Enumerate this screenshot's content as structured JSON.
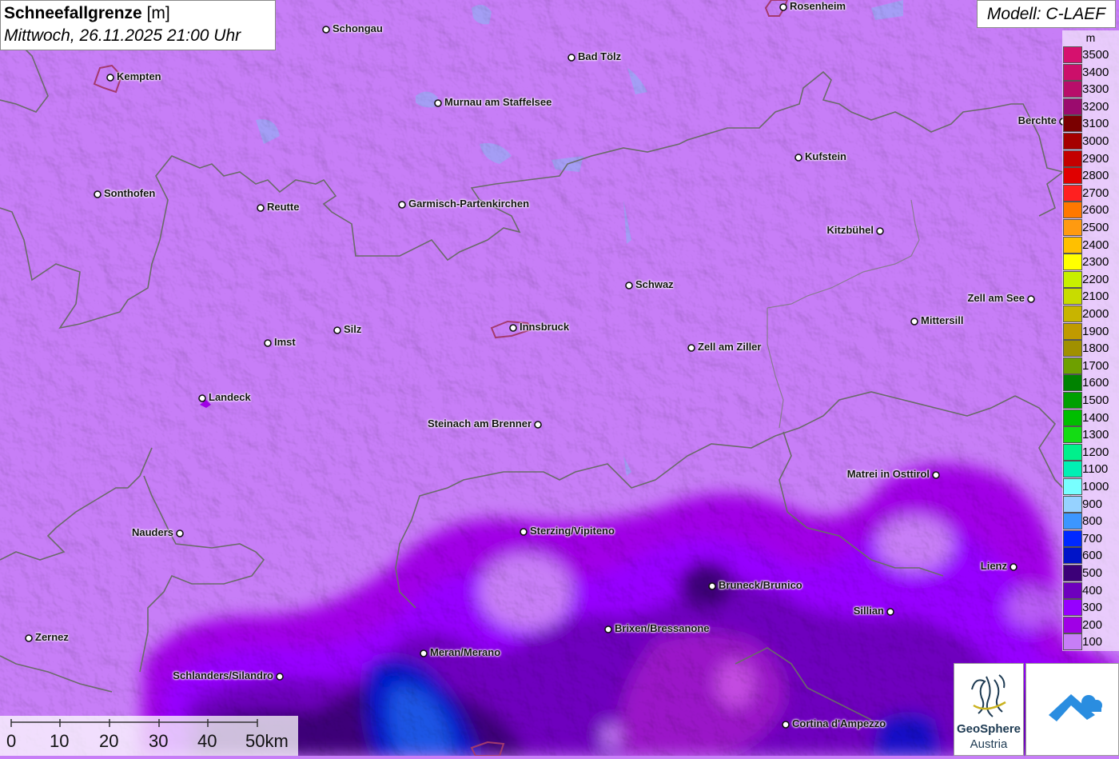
{
  "header": {
    "title": "Schneefallgrenze",
    "unit": "[m]",
    "datetime": "Mittwoch, 26.11.2025 21:00 Uhr"
  },
  "model": "Modell: C-LAEF",
  "legend": {
    "unit": "m",
    "items": [
      {
        "label": "3500",
        "color": "#d6116e"
      },
      {
        "label": "3400",
        "color": "#cc0f6a"
      },
      {
        "label": "3300",
        "color": "#b80e6a"
      },
      {
        "label": "3200",
        "color": "#9b0b6e"
      },
      {
        "label": "3100",
        "color": "#7a0000"
      },
      {
        "label": "3000",
        "color": "#a50000"
      },
      {
        "label": "2900",
        "color": "#c40000"
      },
      {
        "label": "2800",
        "color": "#e00000"
      },
      {
        "label": "2700",
        "color": "#ff2020"
      },
      {
        "label": "2600",
        "color": "#ff7800"
      },
      {
        "label": "2500",
        "color": "#ff9a10"
      },
      {
        "label": "2400",
        "color": "#ffc000"
      },
      {
        "label": "2300",
        "color": "#ffff00"
      },
      {
        "label": "2200",
        "color": "#c8f000"
      },
      {
        "label": "2100",
        "color": "#c8dc00"
      },
      {
        "label": "2000",
        "color": "#c8b400"
      },
      {
        "label": "1900",
        "color": "#c09a00"
      },
      {
        "label": "1800",
        "color": "#a09000"
      },
      {
        "label": "1700",
        "color": "#6ea000"
      },
      {
        "label": "1600",
        "color": "#008200"
      },
      {
        "label": "1500",
        "color": "#00a000"
      },
      {
        "label": "1400",
        "color": "#00be00"
      },
      {
        "label": "1300",
        "color": "#14dc14"
      },
      {
        "label": "1200",
        "color": "#00f08c"
      },
      {
        "label": "1100",
        "color": "#00f0b4"
      },
      {
        "label": "1000",
        "color": "#78ffff"
      },
      {
        "label": "900",
        "color": "#96d2ff"
      },
      {
        "label": "800",
        "color": "#3c96ff"
      },
      {
        "label": "700",
        "color": "#0028ff"
      },
      {
        "label": "600",
        "color": "#0014c8"
      },
      {
        "label": "500",
        "color": "#3c0078"
      },
      {
        "label": "400",
        "color": "#6e00be"
      },
      {
        "label": "300",
        "color": "#9600ff"
      },
      {
        "label": "200",
        "color": "#a000e6"
      },
      {
        "label": "100",
        "color": "#c77ef7"
      }
    ]
  },
  "cities": [
    {
      "name": "Rosenheim",
      "dot": [
        980,
        9
      ],
      "label_side": "right"
    },
    {
      "name": "Schongau",
      "dot": [
        408,
        37
      ],
      "label_side": "right"
    },
    {
      "name": "Kempten",
      "dot": [
        138,
        97
      ],
      "label_side": "right"
    },
    {
      "name": "Bad Tölz",
      "dot": [
        715,
        72
      ],
      "label_side": "right"
    },
    {
      "name": "Murnau am Staffelsee",
      "dot": [
        548,
        129
      ],
      "label_side": "right"
    },
    {
      "name": "Berchte",
      "dot": [
        1330,
        152
      ],
      "label_side": "left"
    },
    {
      "name": "Kufstein",
      "dot": [
        999,
        197
      ],
      "label_side": "right"
    },
    {
      "name": "Sonthofen",
      "dot": [
        122,
        243
      ],
      "label_side": "right"
    },
    {
      "name": "Reutte",
      "dot": [
        326,
        260
      ],
      "label_side": "right"
    },
    {
      "name": "Garmisch-Partenkirchen",
      "dot": [
        503,
        256
      ],
      "label_side": "right"
    },
    {
      "name": "Kitzbühel",
      "dot": [
        1101,
        289
      ],
      "label_side": "left"
    },
    {
      "name": "Schwaz",
      "dot": [
        787,
        357
      ],
      "label_side": "right"
    },
    {
      "name": "Zell am See",
      "dot": [
        1290,
        374
      ],
      "label_side": "left"
    },
    {
      "name": "Mittersill",
      "dot": [
        1144,
        402
      ],
      "label_side": "right"
    },
    {
      "name": "Innsbruck",
      "dot": [
        642,
        410
      ],
      "label_side": "right"
    },
    {
      "name": "Silz",
      "dot": [
        422,
        413
      ],
      "label_side": "right"
    },
    {
      "name": "Imst",
      "dot": [
        335,
        429
      ],
      "label_side": "right"
    },
    {
      "name": "Zell am Ziller",
      "dot": [
        865,
        435
      ],
      "label_side": "right"
    },
    {
      "name": "Landeck",
      "dot": [
        253,
        498
      ],
      "label_side": "right"
    },
    {
      "name": "Steinach am Brenner",
      "dot": [
        673,
        531
      ],
      "label_side": "left"
    },
    {
      "name": "Matrei in Osttirol",
      "dot": [
        1171,
        594
      ],
      "label_side": "left"
    },
    {
      "name": "Nauders",
      "dot": [
        225,
        667
      ],
      "label_side": "left"
    },
    {
      "name": "Sterzing/Vipiteno",
      "dot": [
        655,
        665
      ],
      "label_side": "right"
    },
    {
      "name": "Lienz",
      "dot": [
        1268,
        709
      ],
      "label_side": "left"
    },
    {
      "name": "Bruneck/Brunico",
      "dot": [
        891,
        733
      ],
      "label_side": "right"
    },
    {
      "name": "Sillian",
      "dot": [
        1114,
        765
      ],
      "label_side": "left"
    },
    {
      "name": "Brixen/Bressanone",
      "dot": [
        761,
        787
      ],
      "label_side": "right"
    },
    {
      "name": "Zernez",
      "dot": [
        36,
        798
      ],
      "label_side": "right"
    },
    {
      "name": "Meran/Merano",
      "dot": [
        530,
        817
      ],
      "label_side": "right"
    },
    {
      "name": "Schlanders/Silandro",
      "dot": [
        350,
        846
      ],
      "label_side": "left"
    },
    {
      "name": "Cortina d'Ampezzo",
      "dot": [
        983,
        906
      ],
      "label_side": "right"
    }
  ],
  "scale": {
    "labels": [
      "0",
      "10",
      "20",
      "30",
      "40",
      "50km"
    ]
  },
  "logos": {
    "geosphere_name": "GeoSphere",
    "geosphere_sub": "Austria"
  }
}
